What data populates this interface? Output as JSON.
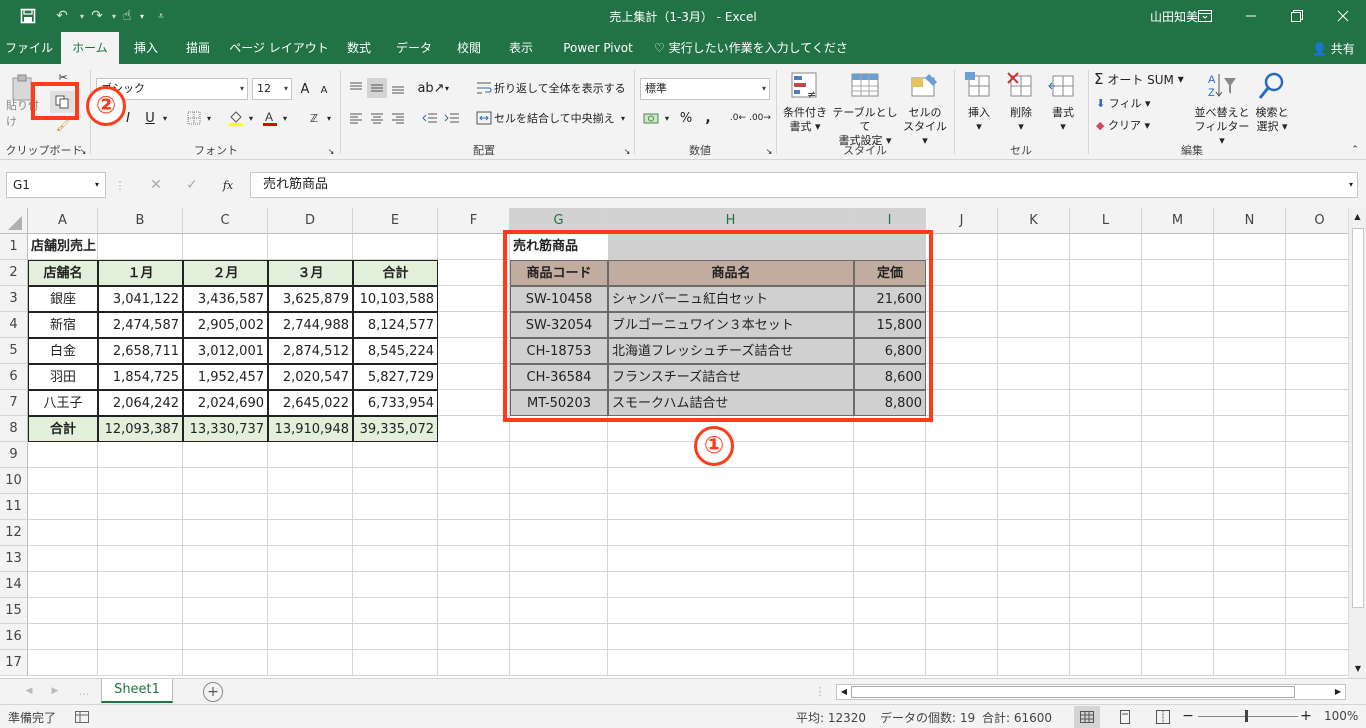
{
  "titlebar": {
    "title": "売上集計（1-3月） - Excel",
    "user": "山田知美",
    "save_icon": "save-icon",
    "undo_icon": "undo-icon",
    "redo_icon": "redo-icon",
    "touch_icon": "touch-mode-icon",
    "customize_icon": "customize-qat-icon"
  },
  "tabs": [
    "ファイル",
    "ホーム",
    "挿入",
    "描画",
    "ページ レイアウト",
    "数式",
    "データ",
    "校閲",
    "表示",
    "Power Pivot"
  ],
  "tellme": "実行したい作業を入力してください",
  "share": "共有",
  "ribbon": {
    "clipboard": {
      "paste": "貼り付け",
      "label": "クリップボード"
    },
    "font": {
      "name": "ゴシック",
      "size": "12",
      "bold": "B",
      "italic": "I",
      "underline": "U",
      "grow": "A",
      "shrink": "A",
      "label": "フォント"
    },
    "alignment": {
      "wrap": "折り返して全体を表示する",
      "merge": "セルを結合して中央揃え",
      "label": "配置"
    },
    "number": {
      "format": "標準",
      "percent": "%",
      "comma": ",",
      "label": "数値"
    },
    "styles": {
      "conditional": [
        "条件付き",
        "書式"
      ],
      "table": [
        "テーブルとして",
        "書式設定"
      ],
      "cell": [
        "セルの",
        "スタイル"
      ],
      "label": "スタイル"
    },
    "cells": {
      "insert": "挿入",
      "delete": "削除",
      "format": "書式",
      "label": "セル"
    },
    "editing": {
      "autosum": "オート SUM",
      "fill": "フィル",
      "clear": "クリア",
      "sort": [
        "並べ替えと",
        "フィルター"
      ],
      "find": [
        "検索と",
        "選択"
      ],
      "label": "編集"
    }
  },
  "formula": {
    "namebox": "G1",
    "cancel": "✕",
    "enter": "✓",
    "fx": "fx",
    "content": "売れ筋商品"
  },
  "columns": [
    "A",
    "B",
    "C",
    "D",
    "E",
    "F",
    "G",
    "H",
    "I",
    "J",
    "K",
    "L",
    "M",
    "N",
    "O"
  ],
  "rows": [
    "1",
    "2",
    "3",
    "4",
    "5",
    "6",
    "7",
    "8",
    "9",
    "10",
    "11",
    "12",
    "13",
    "14",
    "15",
    "16",
    "17"
  ],
  "store_table": {
    "title": "店舗別売上",
    "headers": [
      "店舗名",
      "１月",
      "２月",
      "３月",
      "合計"
    ],
    "rows": [
      [
        "銀座",
        "3,041,122",
        "3,436,587",
        "3,625,879",
        "10,103,588"
      ],
      [
        "新宿",
        "2,474,587",
        "2,905,002",
        "2,744,988",
        "8,124,577"
      ],
      [
        "白金",
        "2,658,711",
        "3,012,001",
        "2,874,512",
        "8,545,224"
      ],
      [
        "羽田",
        "1,854,725",
        "1,952,457",
        "2,020,547",
        "5,827,729"
      ],
      [
        "八王子",
        "2,064,242",
        "2,024,690",
        "2,645,022",
        "6,733,954"
      ]
    ],
    "total": [
      "合計",
      "12,093,387",
      "13,330,737",
      "13,910,948",
      "39,335,072"
    ]
  },
  "product_table": {
    "title": "売れ筋商品",
    "headers": [
      "商品コード",
      "商品名",
      "定価"
    ],
    "rows": [
      [
        "SW-10458",
        "シャンパーニュ紅白セット",
        "21,600"
      ],
      [
        "SW-32054",
        "ブルゴーニュワイン３本セット",
        "15,800"
      ],
      [
        "CH-18753",
        "北海道フレッシュチーズ詰合せ",
        "6,800"
      ],
      [
        "CH-36584",
        "フランスチーズ詰合せ",
        "8,600"
      ],
      [
        "MT-50203",
        "スモークハム詰合せ",
        "8,800"
      ]
    ]
  },
  "annotations": {
    "one": "①",
    "two": "②"
  },
  "sheet_tab": "Sheet1",
  "add_sheet": "+",
  "status": {
    "ready": "準備完了",
    "average": "平均: 12320",
    "count": "データの個数: 19",
    "sum": "合計: 61600",
    "zoom": "100%"
  }
}
